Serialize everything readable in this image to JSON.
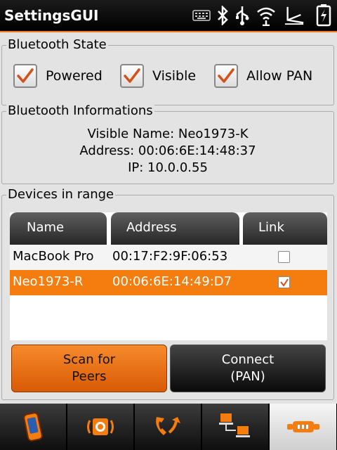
{
  "app": {
    "title": "SettingsGUI"
  },
  "status_icons": [
    "keyboard-icon",
    "bluetooth-icon",
    "usb-icon",
    "wifi-icon",
    "gps-icon",
    "battery-charging-icon"
  ],
  "bluetooth_state": {
    "title": "Bluetooth State",
    "checkboxes": [
      {
        "label": "Powered",
        "checked": true
      },
      {
        "label": "Visible",
        "checked": true
      },
      {
        "label": "Allow PAN",
        "checked": true
      }
    ]
  },
  "bluetooth_info": {
    "title": "Bluetooth Informations",
    "visible_name": "Visible Name: Neo1973-K",
    "address": "Address: 00:06:6E:14:48:37",
    "ip": "IP: 10.0.0.55"
  },
  "devices": {
    "title": "Devices in range",
    "columns": [
      "Name",
      "Address",
      "Link"
    ],
    "rows": [
      {
        "name": "MacBook Pro",
        "address": "00:17:F2:9F:06:53",
        "link": false,
        "selected": false
      },
      {
        "name": "Neo1973-R",
        "address": "00:06:6E:14:49:D7",
        "link": true,
        "selected": true
      }
    ],
    "scan_button": "Scan for\nPeers",
    "connect_button": "Connect\n(PAN)"
  },
  "tabs": [
    {
      "icon": "phone-device-icon",
      "active": false
    },
    {
      "icon": "speaker-icon",
      "active": false
    },
    {
      "icon": "call-forward-icon",
      "active": false
    },
    {
      "icon": "network-icon",
      "active": false
    },
    {
      "icon": "connector-icon",
      "active": true
    }
  ],
  "colors": {
    "accent": "#f57c0f",
    "check": "#d2521a"
  }
}
